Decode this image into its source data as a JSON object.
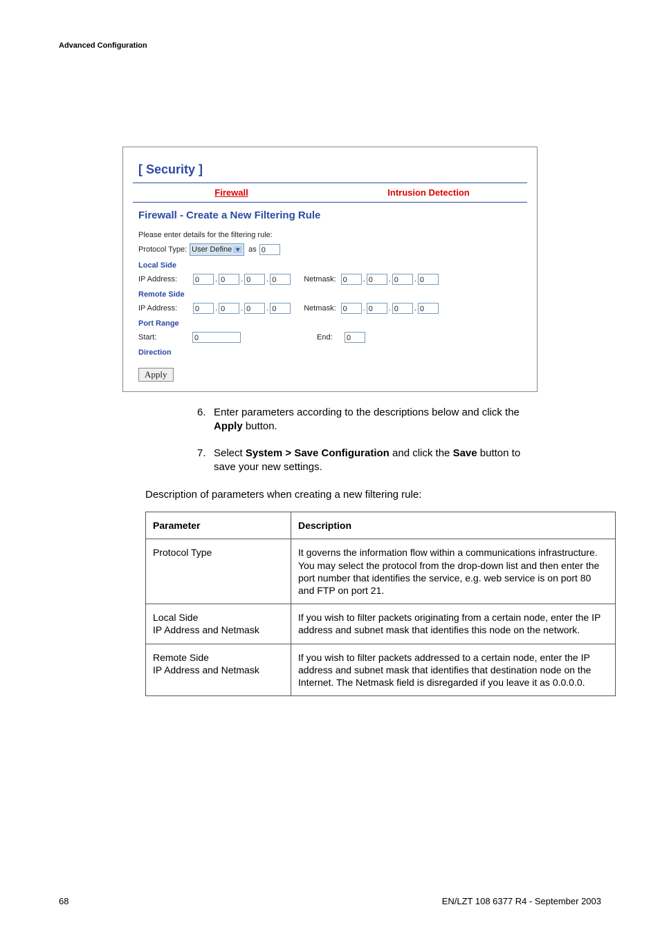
{
  "header": "Advanced Configuration",
  "screenshot": {
    "section_title": "[ Security ]",
    "tabs": {
      "firewall": "Firewall",
      "intrusion": "Intrusion Detection"
    },
    "panel_title": "Firewall - Create a New Filtering Rule",
    "instr": "Please enter details for the filtering rule:",
    "protocol_type_label": "Protocol Type:",
    "protocol_type_value": "User Define",
    "as_label": "as",
    "as_value": "0",
    "local_side": "Local Side",
    "remote_side": "Remote Side",
    "ip_label": "IP Address:",
    "netmask_label": "Netmask:",
    "zero": "0",
    "port_range": "Port Range",
    "start_label": "Start:",
    "end_label": "End:",
    "direction": "Direction",
    "apply": "Apply"
  },
  "steps": {
    "s6_num": "6.",
    "s6_a": "Enter parameters according to the descriptions below and click the ",
    "s6_b": "Apply",
    "s6_c": " button.",
    "s7_num": "7.",
    "s7_a": "Select ",
    "s7_b": "System > Save Configuration",
    "s7_c": " and click the ",
    "s7_d": "Save",
    "s7_e": " button to save your new settings."
  },
  "desc_intro": "Description of parameters when creating a new filtering rule:",
  "table": {
    "h_param": "Parameter",
    "h_desc": "Description",
    "rows": [
      {
        "param_a": "Protocol Type",
        "param_b": "",
        "desc": "It governs the information flow within a communications infrastructure. You may select the protocol from the drop-down list and then enter the port number that identifies the service, e.g. web service is on port 80 and FTP on port 21."
      },
      {
        "param_a": "Local Side",
        "param_b": "IP Address and Netmask",
        "desc": "If you wish to filter packets originating from a certain node, enter the IP address and subnet mask that identifies this node on the network."
      },
      {
        "param_a": "Remote Side",
        "param_b": "IP Address and Netmask",
        "desc": "If you wish to filter packets addressed to a certain node, enter the IP address and subnet mask that identifies that destination node on the Internet. The Netmask field is disregarded if you leave it as 0.0.0.0."
      }
    ]
  },
  "footer": {
    "page": "68",
    "doc": "EN/LZT 108 6377 R4 - September 2003"
  }
}
